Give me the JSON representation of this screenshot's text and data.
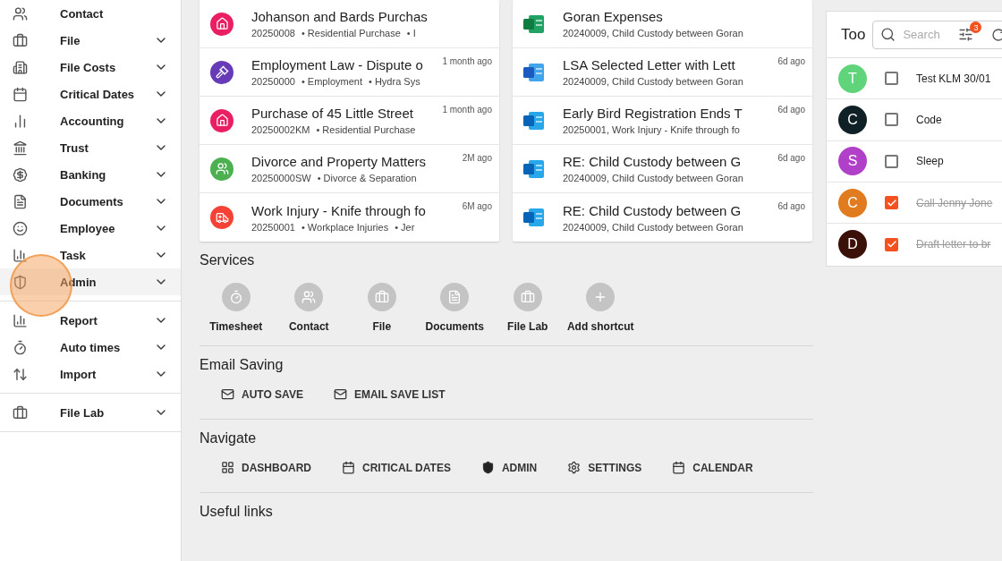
{
  "sidebar": {
    "groups": [
      [
        {
          "label": "Contact",
          "expandable": false,
          "selected": false
        },
        {
          "label": "File",
          "expandable": true,
          "selected": false
        },
        {
          "label": "File Costs",
          "expandable": true,
          "selected": false
        },
        {
          "label": "Critical Dates",
          "expandable": true,
          "selected": false
        },
        {
          "label": "Accounting",
          "expandable": true,
          "selected": false
        },
        {
          "label": "Trust",
          "expandable": true,
          "selected": false
        },
        {
          "label": "Banking",
          "expandable": true,
          "selected": false
        },
        {
          "label": "Documents",
          "expandable": true,
          "selected": false
        },
        {
          "label": "Employee",
          "expandable": true,
          "selected": false
        },
        {
          "label": "Task",
          "expandable": true,
          "selected": false
        },
        {
          "label": "Admin",
          "expandable": true,
          "selected": true
        }
      ],
      [
        {
          "label": "Report",
          "expandable": true,
          "selected": false
        },
        {
          "label": "Auto times",
          "expandable": true,
          "selected": false
        },
        {
          "label": "Import",
          "expandable": true,
          "selected": false
        }
      ],
      [
        {
          "label": "File Lab",
          "expandable": true,
          "selected": false
        }
      ]
    ]
  },
  "files": [
    {
      "title": "Johanson and Bards Purchas",
      "number": "20250008",
      "type": "• Residential Purchase",
      "extra": "• I",
      "kind": "property",
      "color": "#e91e63"
    },
    {
      "title": "Employment Law - Dispute o",
      "number": "20250000",
      "type": "• Employment",
      "extra": "• Hydra Sys",
      "time": "1 month ago",
      "kind": "employment",
      "color": "#673ab7"
    },
    {
      "title": "Purchase of 45 Little Street",
      "number": "20250002KM",
      "type": "• Residential Purchase",
      "time": "1 month ago",
      "kind": "property",
      "color": "#e91e63"
    },
    {
      "title": "Divorce and Property Matters",
      "number": "20250000SW",
      "type": "• Divorce & Separation",
      "time": "2M ago",
      "kind": "family",
      "color": "#4caf50"
    },
    {
      "title": "Work Injury - Knife through fo",
      "number": "20250001",
      "type": "• Workplace Injuries",
      "extra": "• Jer",
      "time": "6M ago",
      "kind": "injury",
      "color": "#f44336"
    }
  ],
  "documents": [
    {
      "title": "Goran Expenses",
      "subtitle": "20240009, Child Custody between Goran",
      "kind": "excel"
    },
    {
      "title": "LSA Selected Letter with Lett",
      "subtitle": "20240009, Child Custody between Goran",
      "time": "6d ago",
      "kind": "word"
    },
    {
      "title": "Early Bird Registration Ends T",
      "subtitle": "20250001, Work Injury - Knife through fo",
      "time": "6d ago",
      "kind": "outlook"
    },
    {
      "title": "RE: Child Custody between G",
      "subtitle": "20240009, Child Custody between Goran",
      "time": "6d ago",
      "kind": "outlook"
    },
    {
      "title": "RE: Child Custody between G",
      "subtitle": "20240009, Child Custody between Goran",
      "time": "6d ago",
      "kind": "outlook"
    }
  ],
  "todo": {
    "title": "Too",
    "search": {
      "placeholder": "Search"
    },
    "filter_count": "3",
    "items": [
      {
        "initial": "T",
        "color": "#5fd47a",
        "text": "Test KLM 30/01",
        "checked": false
      },
      {
        "initial": "C",
        "color": "#0f2027",
        "text": "Code",
        "checked": false
      },
      {
        "initial": "S",
        "color": "#b040c8",
        "text": "Sleep",
        "checked": false
      },
      {
        "initial": "C",
        "color": "#e07b20",
        "text": "Call Jenny Jone",
        "checked": true
      },
      {
        "initial": "D",
        "color": "#3a1008",
        "text": "Draft letter to br",
        "checked": true
      }
    ]
  },
  "services": {
    "title": "Services",
    "shortcuts": [
      "Timesheet",
      "Contact",
      "File",
      "Documents",
      "File Lab",
      "Add shortcut"
    ]
  },
  "email_saving": {
    "title": "Email Saving",
    "actions": [
      "AUTO SAVE",
      "EMAIL SAVE LIST"
    ]
  },
  "navigate": {
    "title": "Navigate",
    "actions": [
      "DASHBOARD",
      "CRITICAL DATES",
      "ADMIN",
      "SETTINGS",
      "CALENDAR"
    ]
  },
  "useful_links": {
    "title": "Useful links"
  }
}
